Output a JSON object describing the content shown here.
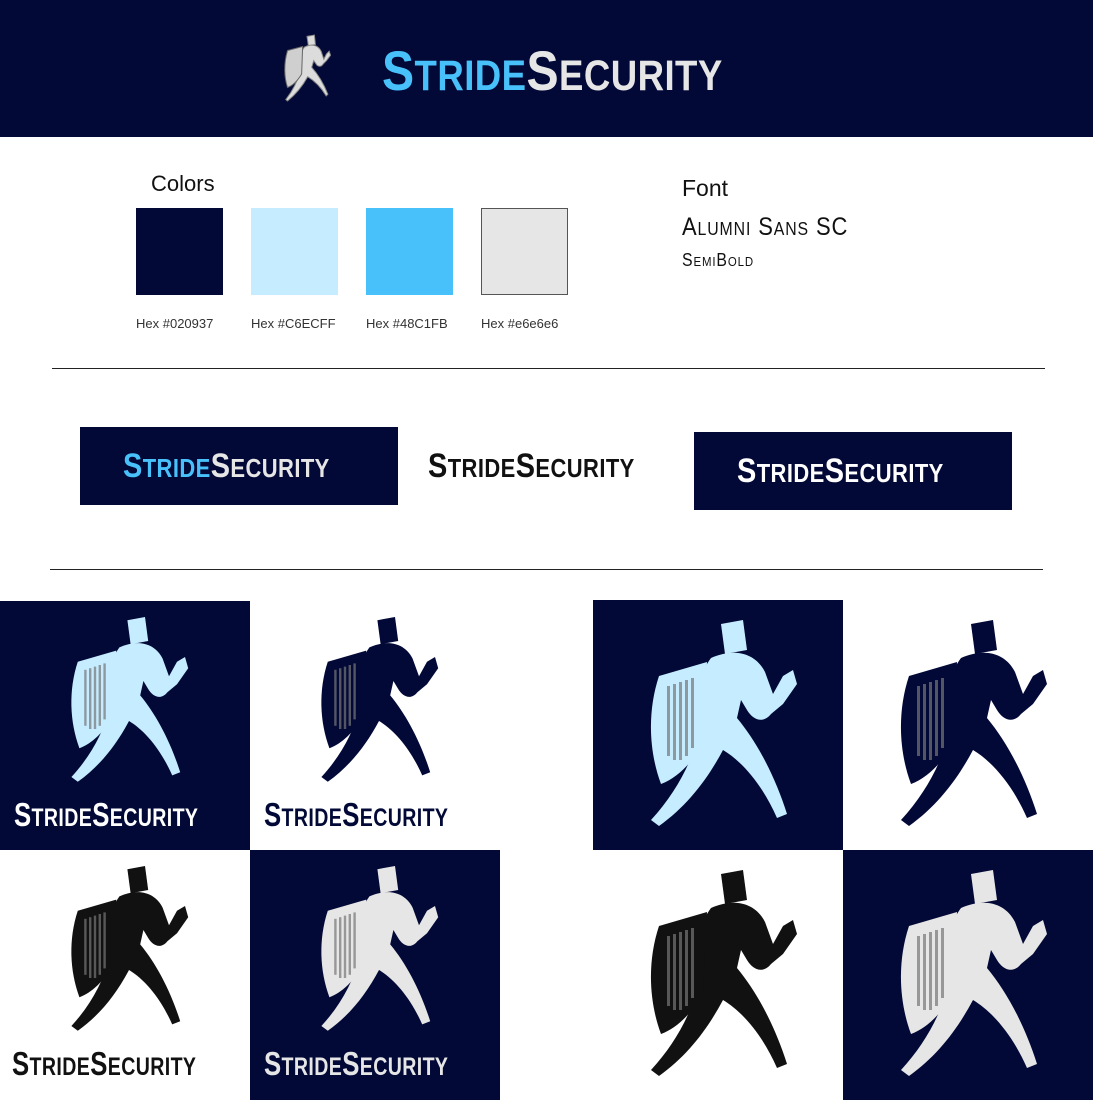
{
  "brand": {
    "part1": "Stride",
    "part2": "Security"
  },
  "colors_section": {
    "title": "Colors",
    "swatches": [
      {
        "hex": "#020937",
        "label": "Hex #020937"
      },
      {
        "hex": "#C6ECFF",
        "label": "Hex #C6ECFF"
      },
      {
        "hex": "#48C1FB",
        "label": "Hex #48C1FB"
      },
      {
        "hex": "#e6e6e6",
        "label": "Hex #e6e6e6"
      }
    ]
  },
  "font_section": {
    "title": "Font",
    "family": "Alumni Sans SC",
    "weight": "SemiBold"
  },
  "palette": {
    "navy": "#020937",
    "pale_blue": "#C6ECFF",
    "sky_blue": "#48C1FB",
    "light_gray": "#e6e6e6",
    "black": "#111111",
    "white": "#ffffff"
  },
  "icon": "running-knight-with-shield-icon"
}
